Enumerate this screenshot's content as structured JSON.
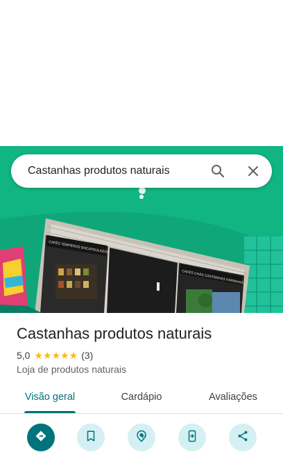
{
  "search": {
    "query": "Castanhas produtos naturais"
  },
  "place": {
    "title": "Castanhas produtos naturais",
    "rating": "5,0",
    "stars": "★★★★★",
    "review_count": "(3)",
    "category": "Loja de produtos naturais"
  },
  "photo_signs": {
    "left": "CAFÉS  TEMPEROS  ENCAPSULADOS",
    "right": "CAFÉS  CHÁS  CASTANHAS  FARINHAS"
  },
  "tabs": [
    "Visão geral",
    "Cardápio",
    "Avaliações"
  ],
  "active_tab": "Visão geral",
  "actions": [
    "directions-icon",
    "bookmark-icon",
    "nearby-icon",
    "send-to-phone-icon",
    "share-icon"
  ],
  "colors": {
    "accent": "#00737b",
    "action_bg": "#d4f0f2",
    "star": "#fbbc04",
    "wall": "#0fa77a"
  }
}
